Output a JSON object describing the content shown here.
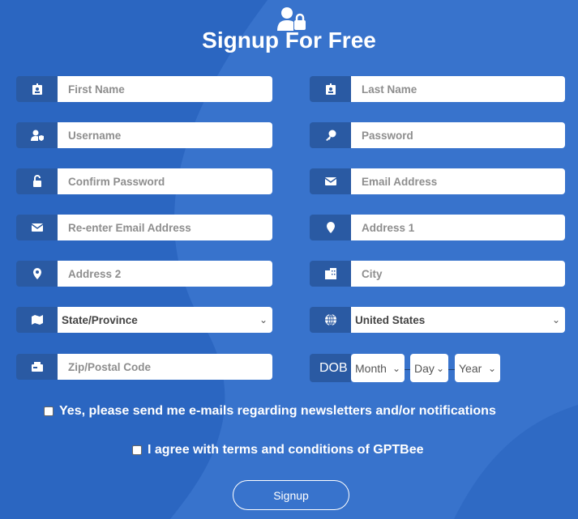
{
  "title": "Signup For Free",
  "fields": {
    "first_name": "First Name",
    "last_name": "Last Name",
    "username": "Username",
    "password": "Password",
    "confirm_password": "Confirm Password",
    "email": "Email Address",
    "reemail": "Re-enter Email Address",
    "address1": "Address 1",
    "address2": "Address 2",
    "city": "City",
    "state": "State/Province",
    "country": "United States",
    "zip": "Zip/Postal Code"
  },
  "dob": {
    "label": "DOB",
    "month": "Month",
    "day": "Day",
    "year": "Year"
  },
  "newsletter_label": "Yes, please send me e-mails regarding newsletters and/or notifications",
  "terms_label": "I agree with terms and conditions of GPTBee",
  "signup_button": "Signup",
  "colors": {
    "background": "#2b66c1",
    "icon_box": "#2a5aa3"
  }
}
